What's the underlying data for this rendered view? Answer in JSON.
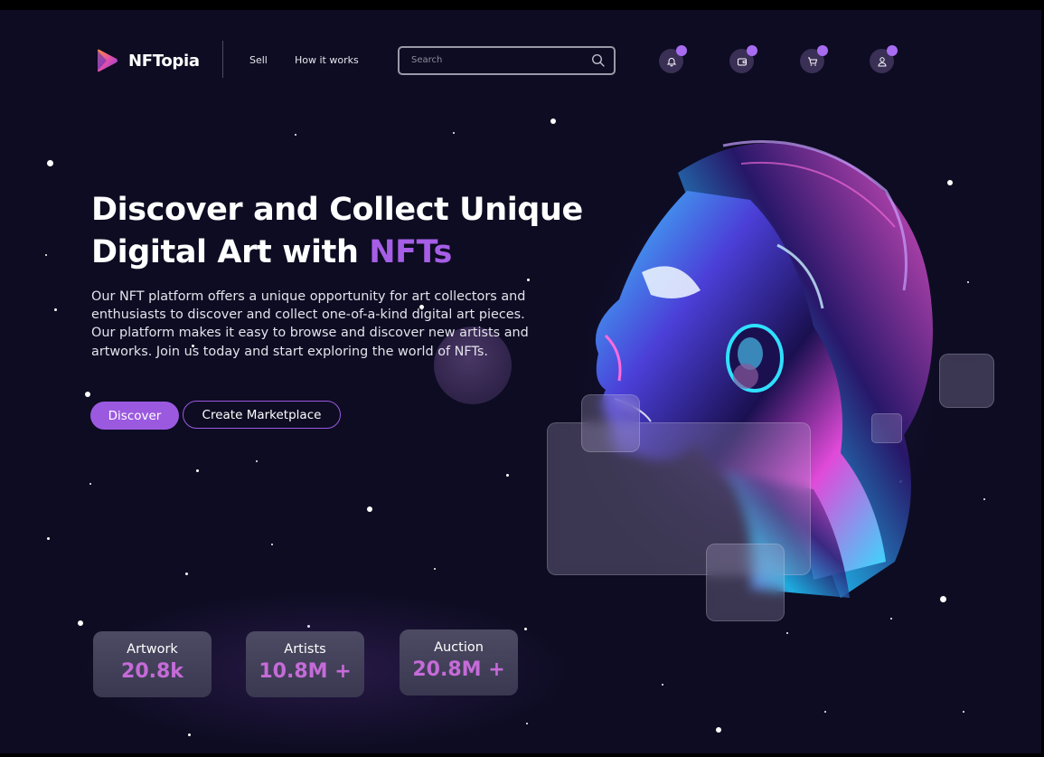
{
  "header": {
    "brand": "NFTopia",
    "nav": {
      "sell": "Sell",
      "how_it_works": "How it works"
    },
    "search_placeholder": "Search",
    "icons": [
      "bell-icon",
      "wallet-icon",
      "cart-icon",
      "user-icon"
    ]
  },
  "hero": {
    "title_line1": "Discover and Collect Unique",
    "title_line2_prefix": "Digital Art with ",
    "title_accent": "NFTs",
    "description": "Our NFT platform offers a unique opportunity for art collectors and enthusiasts to discover and collect one-of-a-kind digital art pieces. Our platform makes it easy to browse and discover new artists and artworks. Join us today and start exploring the world of NFTs.",
    "primary_button": "Discover",
    "secondary_button": "Create Marketplace"
  },
  "stats": [
    {
      "label": "Artwork",
      "value": "20.8k"
    },
    {
      "label": "Artists",
      "value": "10.8M +"
    },
    {
      "label": "Auction",
      "value": "20.8M +"
    }
  ],
  "colors": {
    "background": "#0d0c22",
    "accent": "#9b59e0",
    "accent_text": "#a65ee6",
    "stat_value": "#c56bd8"
  }
}
